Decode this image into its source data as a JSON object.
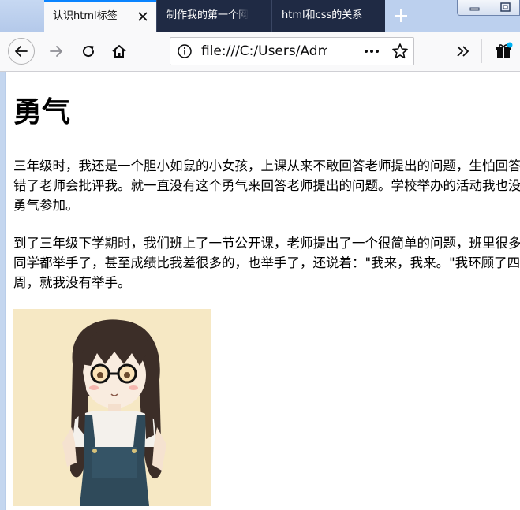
{
  "browser": {
    "tabs": [
      {
        "label": "认识html标签",
        "active": true
      },
      {
        "label": "制作我的第一个网",
        "active": false
      },
      {
        "label": "html和css的关系",
        "active": false
      }
    ],
    "url": "file:///C:/Users/Adm",
    "colors": {
      "tab_active_accent": "#0a84ff",
      "tab_inactive_bg": "#1f2a44",
      "strip_bg": "#bcd0ee"
    }
  },
  "article": {
    "heading": "勇气",
    "paragraphs": [
      "三年级时，我还是一个胆小如鼠的小女孩，上课从来不敢回答老师提出的问题，生怕回答错了老师会批评我。就一直没有这个勇气来回答老师提出的问题。学校举办的活动我也没勇气参加。",
      "到了三年级下学期时，我们班上了一节公开课，老师提出了一个很简单的问题，班里很多同学都举手了，甚至成绩比我差很多的，也举手了，还说着：\"我来，我来。\"我环顾了四周，就我没有举手。"
    ]
  }
}
